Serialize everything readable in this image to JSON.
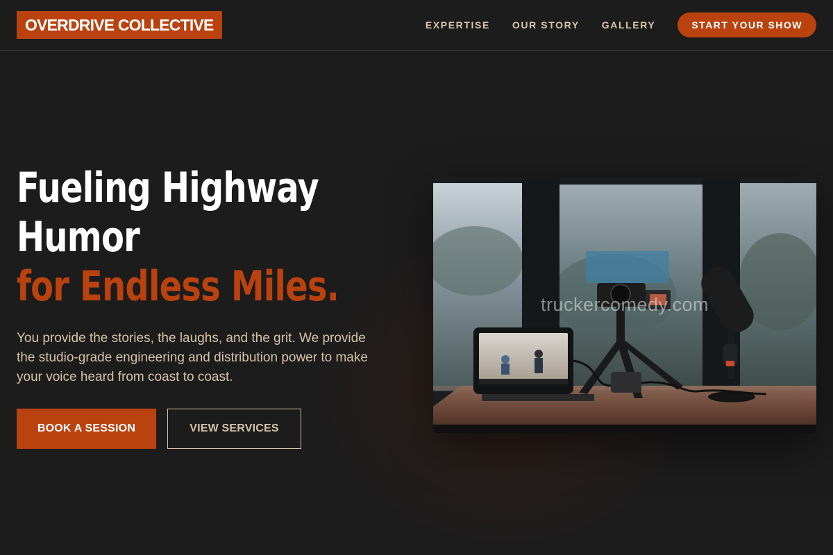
{
  "header": {
    "logo": "OVERDRIVE COLLECTIVE",
    "nav": [
      {
        "label": "EXPERTISE"
      },
      {
        "label": "OUR STORY"
      },
      {
        "label": "GALLERY"
      }
    ],
    "cta_label": "START YOUR SHOW"
  },
  "hero": {
    "title_line1": "Fueling Highway",
    "title_line2": "Humor",
    "title_accent": "for Endless Miles.",
    "description": "You provide the stories, the laughs, and the grit. We provide the studio-grade engineering and distribution power to make your voice heard from coast to coast.",
    "primary_button": "BOOK A SESSION",
    "secondary_button": "VIEW SERVICES",
    "image_watermark": "truckercomedy.com"
  },
  "colors": {
    "background": "#1d1c1c",
    "accent": "#b9420f",
    "muted_text": "#d5c3a8"
  },
  "icons": {
    "hero_image": "podcast-studio-setup-photo"
  }
}
